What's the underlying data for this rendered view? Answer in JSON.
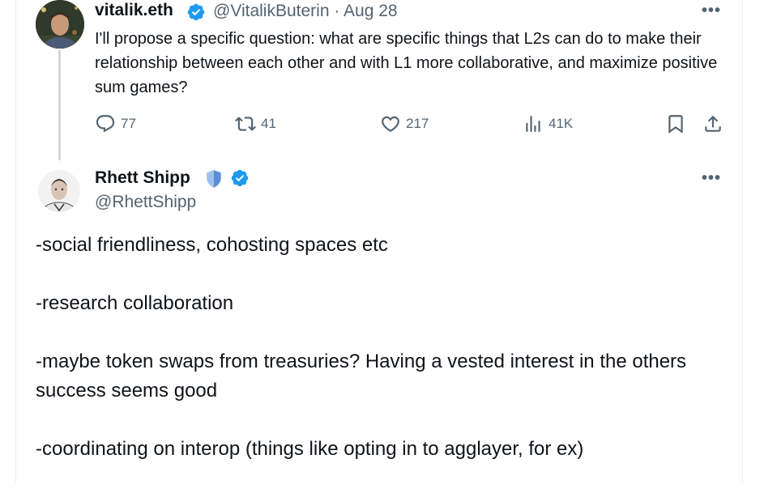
{
  "original_tweet": {
    "author_name": "vitalik.eth",
    "handle": "@VitalikButerin",
    "separator": "·",
    "date": "Aug 28",
    "more_label": "•••",
    "text": "I'll propose a specific question: what are specific things that L2s can do to make their relationship between each other and with L1 more collaborative, and maximize positive sum games?",
    "stats": {
      "replies": "77",
      "reposts": "41",
      "likes": "217",
      "views": "41K"
    }
  },
  "reply_tweet": {
    "author_name": "Rhett Shipp",
    "handle": "@RhettShipp",
    "more_label": "•••",
    "paragraphs": [
      "-social friendliness, cohosting spaces etc",
      "-research collaboration",
      "-maybe token swaps from treasuries? Having a vested interest in the others success seems good",
      "-coordinating on interop (things like opting in to agglayer, for ex)"
    ]
  },
  "colors": {
    "verified": "#1d9bf0",
    "muted": "#536471",
    "text": "#0f1419",
    "shield": "#5b8dd6"
  },
  "icons": [
    "verified-badge-icon",
    "reply-icon",
    "repost-icon",
    "like-icon",
    "views-icon",
    "bookmark-icon",
    "share-icon",
    "shield-icon"
  ]
}
